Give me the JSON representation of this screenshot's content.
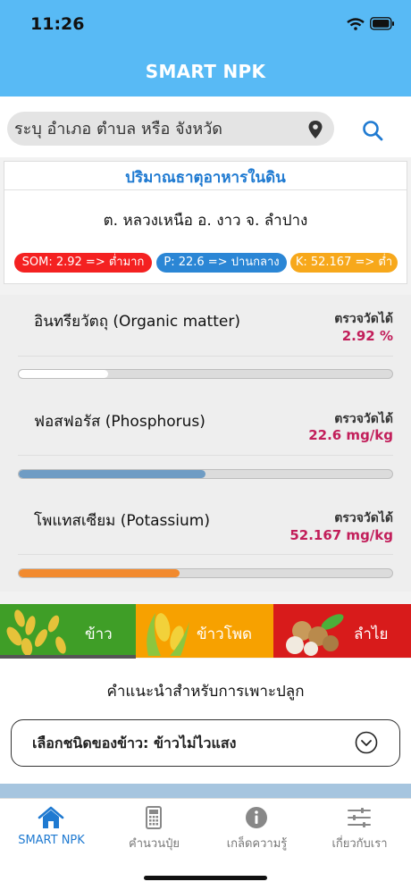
{
  "status_bar": {
    "time": "11:26"
  },
  "header": {
    "title": "SMART NPK"
  },
  "search": {
    "placeholder": "ระบุ อำเภอ ตำบล หรือ จังหวัด"
  },
  "summary_card": {
    "title": "ปริมาณธาตุอาหารในดิน",
    "location": "ต. หลวงเหนือ อ. งาว จ. ลำปาง",
    "badges": [
      {
        "text": "SOM: 2.92 => ต่ำมาก",
        "color": "#f42121"
      },
      {
        "text": "P: 22.6 => ปานกลาง",
        "color": "#2b86d5"
      },
      {
        "text": "K: 52.167 => ต่ำ",
        "color": "#f7a81b"
      }
    ]
  },
  "nutrients": [
    {
      "name": "อินทรียวัตถุ  (Organic matter)",
      "measured_label": "ตรวจวัดได้",
      "value": "2.92 %",
      "level": 0.24,
      "color": "#ffffff"
    },
    {
      "name": "ฟอสฟอรัส  (Phosphorus)",
      "measured_label": "ตรวจวัดได้",
      "value": "22.6 mg/kg",
      "level": 0.5,
      "color": "#6f9cc4"
    },
    {
      "name": "โพแทสเซียม  (Potassium)",
      "measured_label": "ตรวจวัดได้",
      "value": "52.167 mg/kg",
      "level": 0.43,
      "color": "#f28a2e"
    }
  ],
  "crops": [
    {
      "label": "ข้าว",
      "selected": true
    },
    {
      "label": "ข้าวโพด",
      "selected": false
    },
    {
      "label": "ลำไย",
      "selected": false
    }
  ],
  "recommendation": {
    "title": "คำแนะนำสำหรับการเพาะปลูก",
    "select_label": "เลือกชนิดของข้าว: ข้าวไม่ไวแสง"
  },
  "tabs": [
    {
      "label": "SMART NPK",
      "icon": "home-icon",
      "active": true
    },
    {
      "label": "คำนวนปุ๋ย",
      "icon": "calculator-icon",
      "active": false
    },
    {
      "label": "เกล็ดความรู้",
      "icon": "info-icon",
      "active": false
    },
    {
      "label": "เกี่ยวกับเรา",
      "icon": "sliders-icon",
      "active": false
    }
  ],
  "colors": {
    "header": "#58baf5",
    "accent": "#1f7ad1",
    "value": "#c21e5a"
  }
}
